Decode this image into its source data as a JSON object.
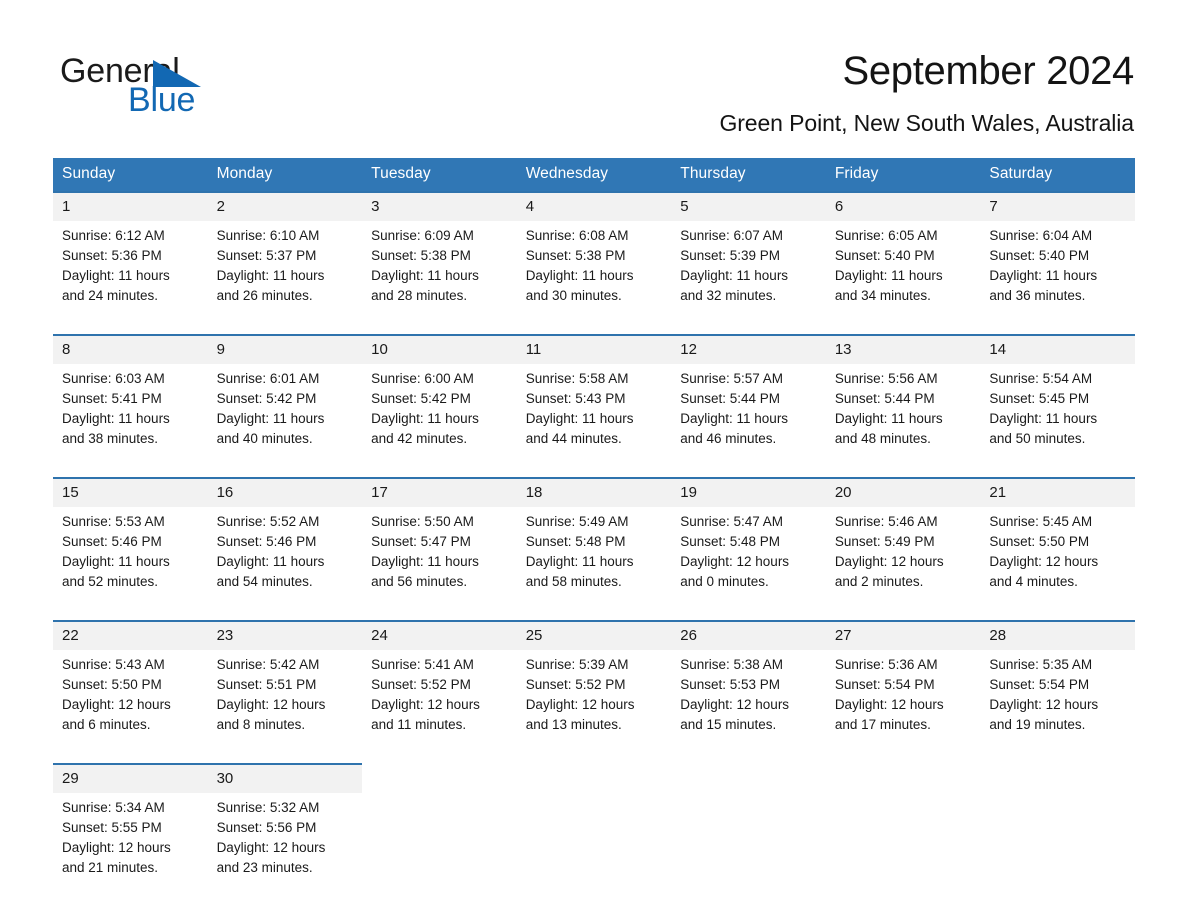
{
  "brand": {
    "name_part1": "General",
    "name_part2": "Blue",
    "triangle_icon": "triangle-icon",
    "accent_color": "#1268b3"
  },
  "header": {
    "title": "September 2024",
    "subtitle": "Green Point, New South Wales, Australia"
  },
  "theme": {
    "header_row_bg": "#3077b5",
    "week_divider": "#2f73ad",
    "daynum_bg": "#f2f2f2",
    "page_bg": "#ffffff"
  },
  "weekdays": [
    "Sunday",
    "Monday",
    "Tuesday",
    "Wednesday",
    "Thursday",
    "Friday",
    "Saturday"
  ],
  "labels": {
    "sunrise_prefix": "Sunrise:",
    "sunset_prefix": "Sunset:",
    "daylight_prefix": "Daylight:"
  },
  "weeks": [
    {
      "days": [
        {
          "num": "1",
          "sunrise": "Sunrise: 6:12 AM",
          "sunset": "Sunset: 5:36 PM",
          "daylight1": "Daylight: 11 hours",
          "daylight2": "and 24 minutes."
        },
        {
          "num": "2",
          "sunrise": "Sunrise: 6:10 AM",
          "sunset": "Sunset: 5:37 PM",
          "daylight1": "Daylight: 11 hours",
          "daylight2": "and 26 minutes."
        },
        {
          "num": "3",
          "sunrise": "Sunrise: 6:09 AM",
          "sunset": "Sunset: 5:38 PM",
          "daylight1": "Daylight: 11 hours",
          "daylight2": "and 28 minutes."
        },
        {
          "num": "4",
          "sunrise": "Sunrise: 6:08 AM",
          "sunset": "Sunset: 5:38 PM",
          "daylight1": "Daylight: 11 hours",
          "daylight2": "and 30 minutes."
        },
        {
          "num": "5",
          "sunrise": "Sunrise: 6:07 AM",
          "sunset": "Sunset: 5:39 PM",
          "daylight1": "Daylight: 11 hours",
          "daylight2": "and 32 minutes."
        },
        {
          "num": "6",
          "sunrise": "Sunrise: 6:05 AM",
          "sunset": "Sunset: 5:40 PM",
          "daylight1": "Daylight: 11 hours",
          "daylight2": "and 34 minutes."
        },
        {
          "num": "7",
          "sunrise": "Sunrise: 6:04 AM",
          "sunset": "Sunset: 5:40 PM",
          "daylight1": "Daylight: 11 hours",
          "daylight2": "and 36 minutes."
        }
      ]
    },
    {
      "days": [
        {
          "num": "8",
          "sunrise": "Sunrise: 6:03 AM",
          "sunset": "Sunset: 5:41 PM",
          "daylight1": "Daylight: 11 hours",
          "daylight2": "and 38 minutes."
        },
        {
          "num": "9",
          "sunrise": "Sunrise: 6:01 AM",
          "sunset": "Sunset: 5:42 PM",
          "daylight1": "Daylight: 11 hours",
          "daylight2": "and 40 minutes."
        },
        {
          "num": "10",
          "sunrise": "Sunrise: 6:00 AM",
          "sunset": "Sunset: 5:42 PM",
          "daylight1": "Daylight: 11 hours",
          "daylight2": "and 42 minutes."
        },
        {
          "num": "11",
          "sunrise": "Sunrise: 5:58 AM",
          "sunset": "Sunset: 5:43 PM",
          "daylight1": "Daylight: 11 hours",
          "daylight2": "and 44 minutes."
        },
        {
          "num": "12",
          "sunrise": "Sunrise: 5:57 AM",
          "sunset": "Sunset: 5:44 PM",
          "daylight1": "Daylight: 11 hours",
          "daylight2": "and 46 minutes."
        },
        {
          "num": "13",
          "sunrise": "Sunrise: 5:56 AM",
          "sunset": "Sunset: 5:44 PM",
          "daylight1": "Daylight: 11 hours",
          "daylight2": "and 48 minutes."
        },
        {
          "num": "14",
          "sunrise": "Sunrise: 5:54 AM",
          "sunset": "Sunset: 5:45 PM",
          "daylight1": "Daylight: 11 hours",
          "daylight2": "and 50 minutes."
        }
      ]
    },
    {
      "days": [
        {
          "num": "15",
          "sunrise": "Sunrise: 5:53 AM",
          "sunset": "Sunset: 5:46 PM",
          "daylight1": "Daylight: 11 hours",
          "daylight2": "and 52 minutes."
        },
        {
          "num": "16",
          "sunrise": "Sunrise: 5:52 AM",
          "sunset": "Sunset: 5:46 PM",
          "daylight1": "Daylight: 11 hours",
          "daylight2": "and 54 minutes."
        },
        {
          "num": "17",
          "sunrise": "Sunrise: 5:50 AM",
          "sunset": "Sunset: 5:47 PM",
          "daylight1": "Daylight: 11 hours",
          "daylight2": "and 56 minutes."
        },
        {
          "num": "18",
          "sunrise": "Sunrise: 5:49 AM",
          "sunset": "Sunset: 5:48 PM",
          "daylight1": "Daylight: 11 hours",
          "daylight2": "and 58 minutes."
        },
        {
          "num": "19",
          "sunrise": "Sunrise: 5:47 AM",
          "sunset": "Sunset: 5:48 PM",
          "daylight1": "Daylight: 12 hours",
          "daylight2": "and 0 minutes."
        },
        {
          "num": "20",
          "sunrise": "Sunrise: 5:46 AM",
          "sunset": "Sunset: 5:49 PM",
          "daylight1": "Daylight: 12 hours",
          "daylight2": "and 2 minutes."
        },
        {
          "num": "21",
          "sunrise": "Sunrise: 5:45 AM",
          "sunset": "Sunset: 5:50 PM",
          "daylight1": "Daylight: 12 hours",
          "daylight2": "and 4 minutes."
        }
      ]
    },
    {
      "days": [
        {
          "num": "22",
          "sunrise": "Sunrise: 5:43 AM",
          "sunset": "Sunset: 5:50 PM",
          "daylight1": "Daylight: 12 hours",
          "daylight2": "and 6 minutes."
        },
        {
          "num": "23",
          "sunrise": "Sunrise: 5:42 AM",
          "sunset": "Sunset: 5:51 PM",
          "daylight1": "Daylight: 12 hours",
          "daylight2": "and 8 minutes."
        },
        {
          "num": "24",
          "sunrise": "Sunrise: 5:41 AM",
          "sunset": "Sunset: 5:52 PM",
          "daylight1": "Daylight: 12 hours",
          "daylight2": "and 11 minutes."
        },
        {
          "num": "25",
          "sunrise": "Sunrise: 5:39 AM",
          "sunset": "Sunset: 5:52 PM",
          "daylight1": "Daylight: 12 hours",
          "daylight2": "and 13 minutes."
        },
        {
          "num": "26",
          "sunrise": "Sunrise: 5:38 AM",
          "sunset": "Sunset: 5:53 PM",
          "daylight1": "Daylight: 12 hours",
          "daylight2": "and 15 minutes."
        },
        {
          "num": "27",
          "sunrise": "Sunrise: 5:36 AM",
          "sunset": "Sunset: 5:54 PM",
          "daylight1": "Daylight: 12 hours",
          "daylight2": "and 17 minutes."
        },
        {
          "num": "28",
          "sunrise": "Sunrise: 5:35 AM",
          "sunset": "Sunset: 5:54 PM",
          "daylight1": "Daylight: 12 hours",
          "daylight2": "and 19 minutes."
        }
      ]
    },
    {
      "days": [
        {
          "num": "29",
          "sunrise": "Sunrise: 5:34 AM",
          "sunset": "Sunset: 5:55 PM",
          "daylight1": "Daylight: 12 hours",
          "daylight2": "and 21 minutes."
        },
        {
          "num": "30",
          "sunrise": "Sunrise: 5:32 AM",
          "sunset": "Sunset: 5:56 PM",
          "daylight1": "Daylight: 12 hours",
          "daylight2": "and 23 minutes."
        },
        {
          "num": "",
          "sunrise": "",
          "sunset": "",
          "daylight1": "",
          "daylight2": ""
        },
        {
          "num": "",
          "sunrise": "",
          "sunset": "",
          "daylight1": "",
          "daylight2": ""
        },
        {
          "num": "",
          "sunrise": "",
          "sunset": "",
          "daylight1": "",
          "daylight2": ""
        },
        {
          "num": "",
          "sunrise": "",
          "sunset": "",
          "daylight1": "",
          "daylight2": ""
        },
        {
          "num": "",
          "sunrise": "",
          "sunset": "",
          "daylight1": "",
          "daylight2": ""
        }
      ]
    }
  ]
}
